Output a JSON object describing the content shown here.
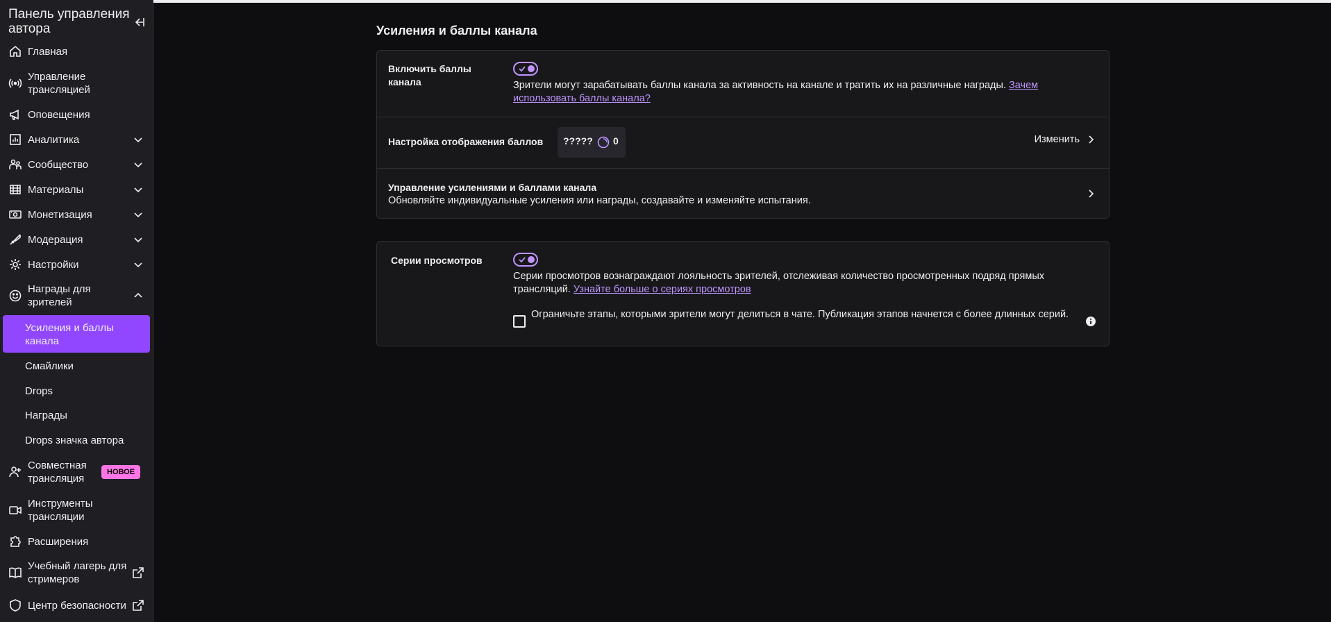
{
  "sidebar": {
    "title": "Панель управления автора",
    "items": [
      {
        "label": "Главная",
        "icon": "home-icon"
      },
      {
        "label": "Управление трансляцией",
        "icon": "broadcast-icon"
      },
      {
        "label": "Оповещения",
        "icon": "megaphone-icon"
      },
      {
        "label": "Аналитика",
        "icon": "analytics-icon"
      },
      {
        "label": "Сообщество",
        "icon": "community-icon"
      },
      {
        "label": "Материалы",
        "icon": "content-icon"
      },
      {
        "label": "Монетизация",
        "icon": "monetization-icon"
      },
      {
        "label": "Модерация",
        "icon": "sword-icon"
      },
      {
        "label": "Настройки",
        "icon": "gear-icon"
      },
      {
        "label": "Награды для зрителей",
        "icon": "smile-icon"
      },
      {
        "label": "Совместная трансляция",
        "icon": "add-user-icon",
        "badge": "НОВОЕ"
      },
      {
        "label": "Инструменты трансляции",
        "icon": "camera-icon"
      },
      {
        "label": "Расширения",
        "icon": "puzzle-icon"
      },
      {
        "label": "Учебный лагерь для стримеров",
        "icon": "book-icon"
      },
      {
        "label": "Центр безопасности",
        "icon": "shield-icon"
      }
    ],
    "subitems": [
      "Усиления и баллы канала",
      "Смайлики",
      "Drops",
      "Награды",
      "Drops значка автора"
    ]
  },
  "main": {
    "title": "Усиления и баллы канала",
    "card1": {
      "enable_label": "Включить баллы канала",
      "enable_desc": "Зрители могут зарабатывать баллы канала за активность на канале и тратить их на различные награды.",
      "enable_link": "Зачем использовать баллы канала?",
      "display_label": "Настройка отображения баллов",
      "points_name": "?????",
      "points_value": "0",
      "change_label": "Изменить",
      "manage_title": "Управление усилениями и баллами канала",
      "manage_desc": "Обновляйте индивидуальные усиления или награды, создавайте и изменяйте испытания."
    },
    "card2": {
      "label": "Серии просмотров",
      "desc": "Серии просмотров вознаграждают лояльность зрителей, отслеживая количество просмотренных подряд прямых трансляций.",
      "link": "Узнайте больше о сериях просмотров",
      "checkbox_label": "Ограничьте этапы, которыми зрители могут делиться в чате. Публикация этапов начнется с более длинных серий."
    }
  },
  "colors": {
    "accent": "#9147ff",
    "link": "#bf94ff",
    "badge": "#ff75e6"
  }
}
